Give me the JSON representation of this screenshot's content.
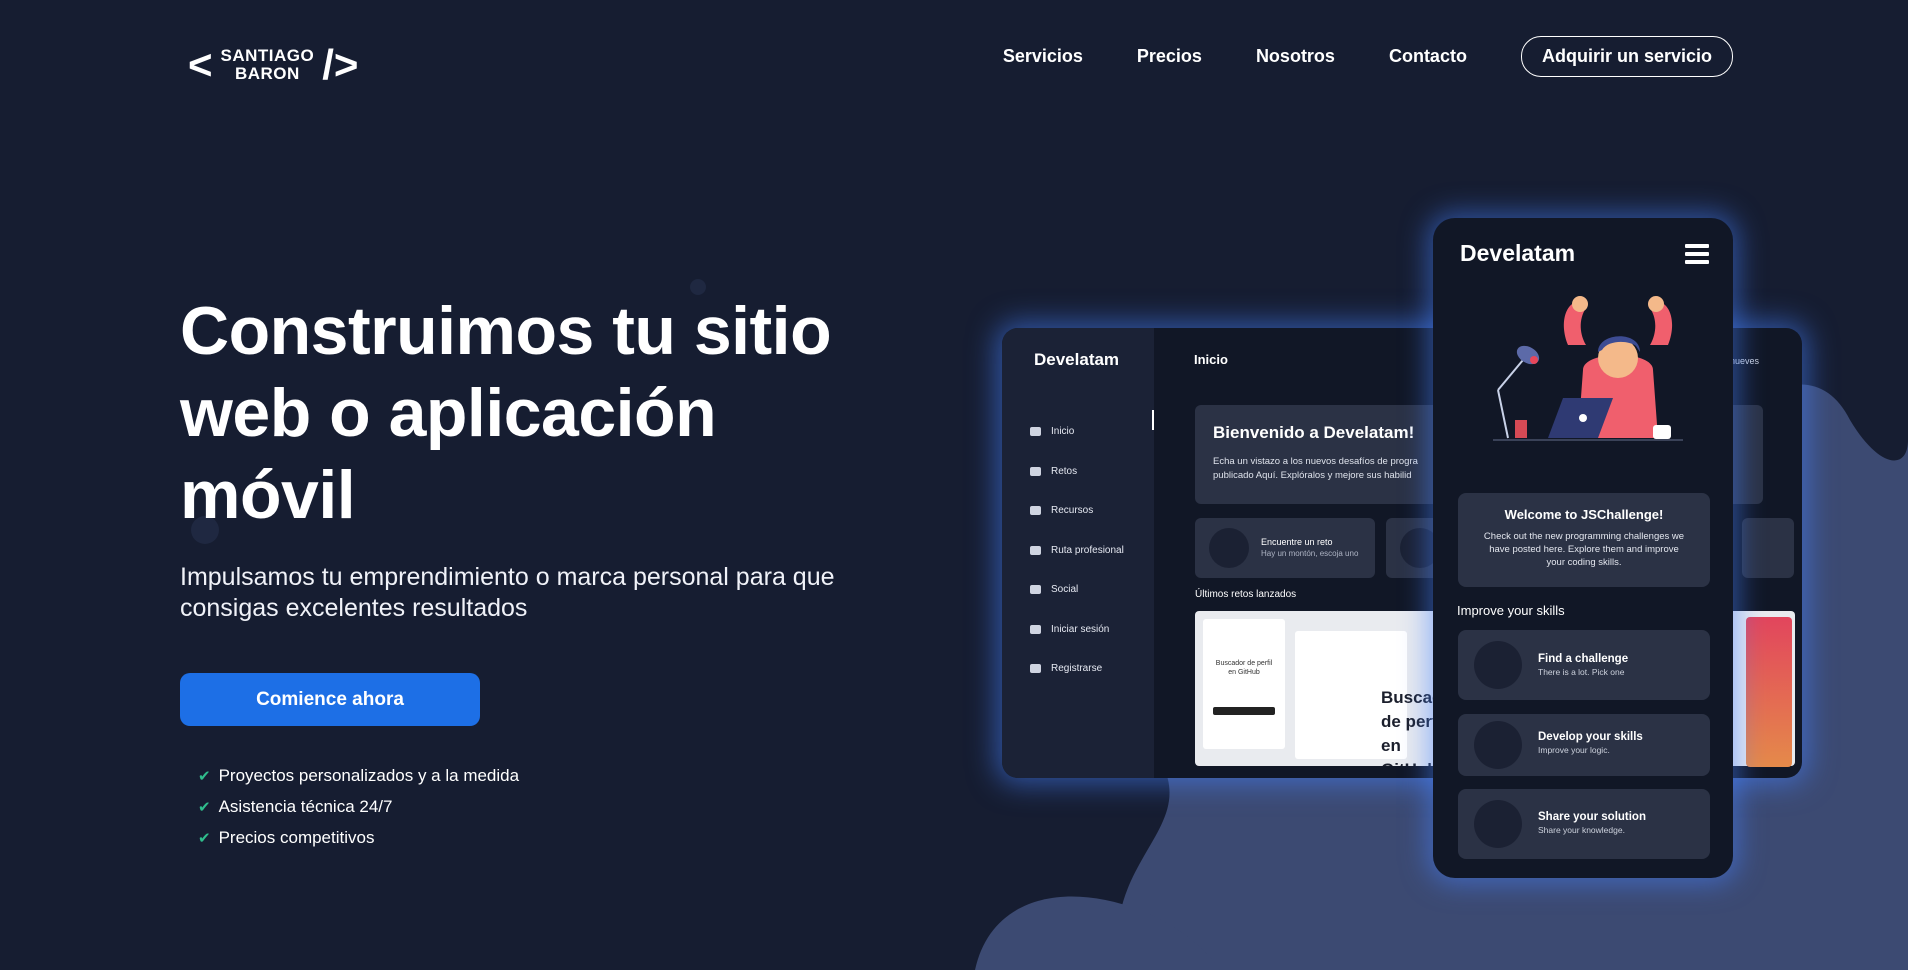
{
  "logo": {
    "left_bracket": "<",
    "line1": "SANTIAGO",
    "line2": "BARON",
    "right_bracket": "/>"
  },
  "nav": {
    "items": [
      {
        "label": "Servicios"
      },
      {
        "label": "Precios"
      },
      {
        "label": "Nosotros"
      },
      {
        "label": "Contacto"
      }
    ],
    "cta": "Adquirir un servicio"
  },
  "hero": {
    "title": "Construimos tu sitio web o aplicación móvil",
    "subtitle": "Impulsamos tu emprendimiento o marca personal para que consigas excelentes resultados",
    "button": "Comience ahora",
    "features": [
      "Proyectos personalizados y a la medida",
      "Asistencia técnica 24/7",
      "Precios competitivos"
    ]
  },
  "desktop_mockup": {
    "brand": "Develatam",
    "header": "Inicio",
    "right_text": "nueves",
    "menu": [
      "Inicio",
      "Retos",
      "Recursos",
      "Ruta profesional",
      "Social",
      "Iniciar sesión",
      "Registrarse"
    ],
    "welcome_title": "Bienvenido a Develatam!",
    "welcome_text": "Echa un vistazo a los nuevos desafíos de progra publicado Aquí. Explóralos y mejore sus habilid",
    "card1_title": "Encuentre un reto",
    "card1_sub": "Hay un montón, escoja uno",
    "section": "Últimos retos lanzados",
    "challenge_card_title": "Buscador de perfil en GitHub",
    "challenge_big": "Buscador de perfil en GitHub"
  },
  "phone_mockup": {
    "brand": "Develatam",
    "welcome_title": "Welcome to JSChallenge!",
    "welcome_text": "Check out the new programming challenges we have posted here. Explore them and improve your coding skills.",
    "section": "Improve your skills",
    "items": [
      {
        "title": "Find a challenge",
        "sub": "There is a lot. Pick one"
      },
      {
        "title": "Develop your skills",
        "sub": "Improve your logic."
      },
      {
        "title": "Share your solution",
        "sub": "Share your knowledge."
      }
    ]
  },
  "colors": {
    "background": "#161d31",
    "accent": "#1d6fe6",
    "check": "#2fbd8c",
    "blob": "#3c4a72"
  }
}
